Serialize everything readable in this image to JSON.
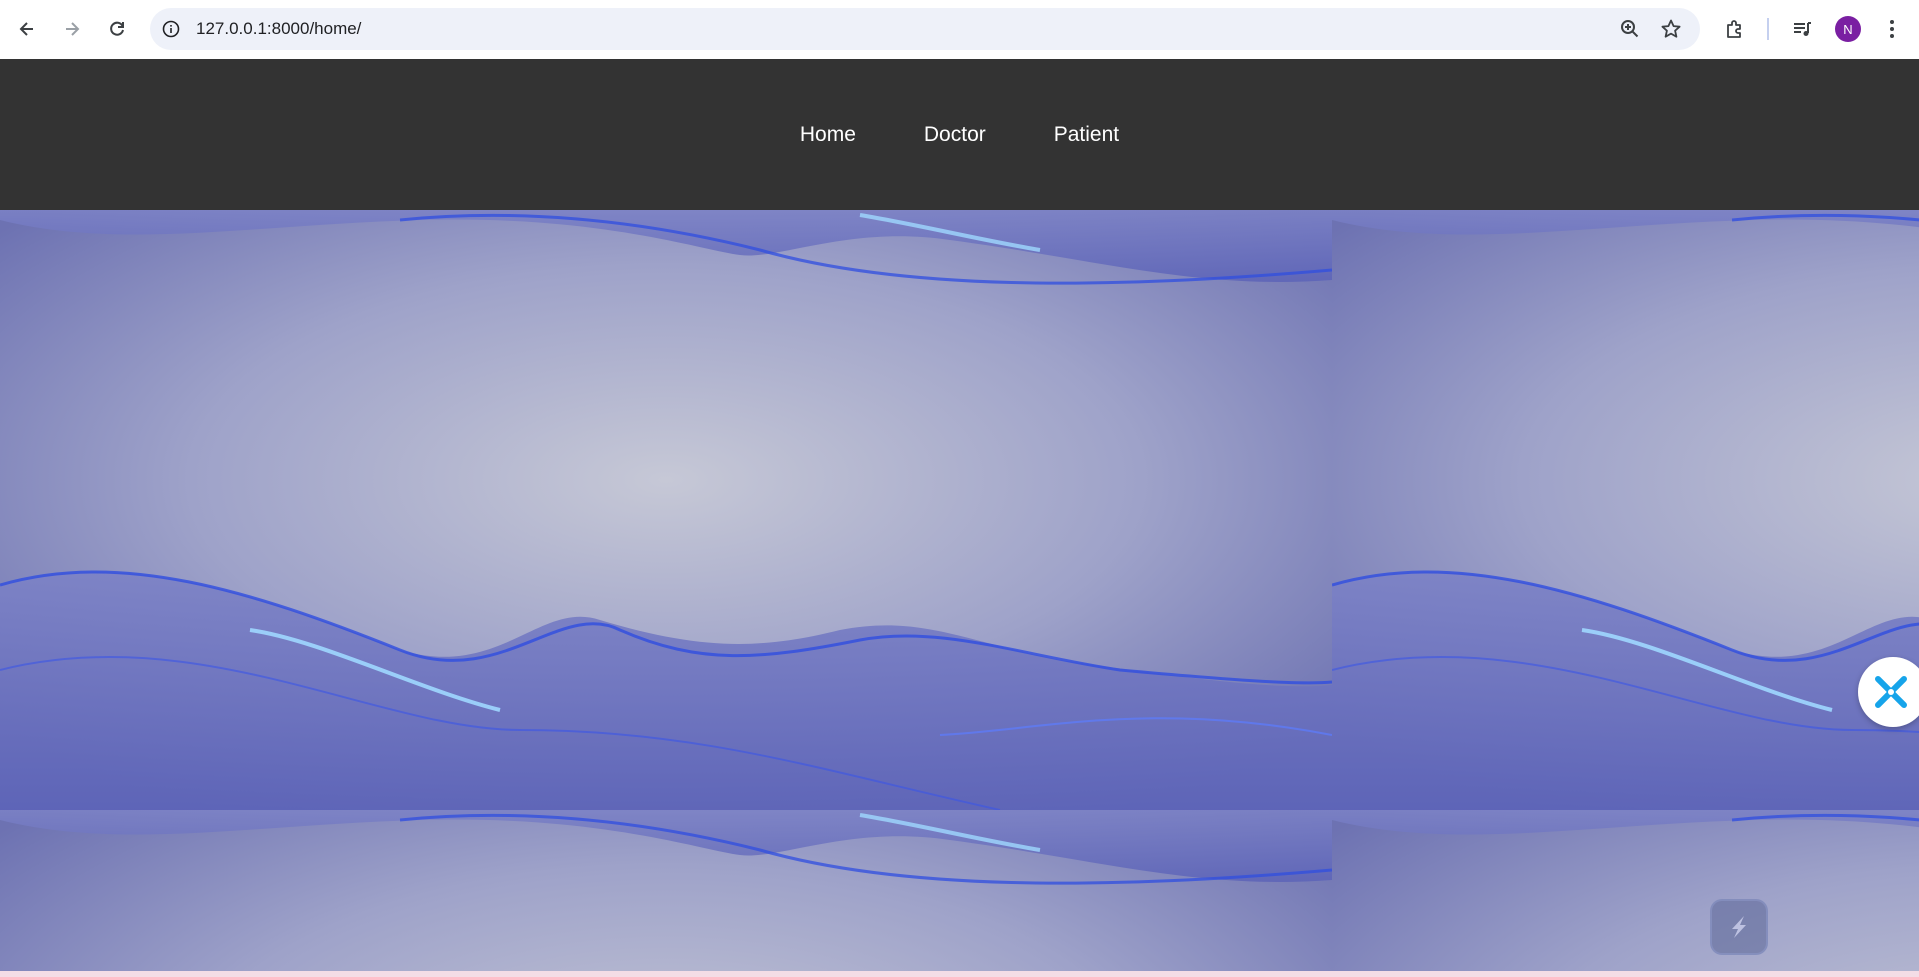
{
  "browser": {
    "url": "127.0.0.1:8000/home/",
    "profile_initial": "N",
    "icons": {
      "back": "arrow-left-icon",
      "forward": "arrow-right-icon",
      "reload": "reload-icon",
      "site_info": "info-icon",
      "zoom": "zoom-in-icon",
      "bookmark": "star-icon",
      "extensions": "puzzle-icon",
      "media": "media-list-icon",
      "menu": "kebab-menu-icon"
    }
  },
  "nav": {
    "items": [
      {
        "label": "Home"
      },
      {
        "label": "Doctor"
      },
      {
        "label": "Patient"
      }
    ]
  },
  "colors": {
    "navbar_bg": "#333333",
    "hero_base": "#8a8fc2",
    "wave_highlight": "#2f4de0",
    "avatar_bg": "#7a1fa2"
  }
}
